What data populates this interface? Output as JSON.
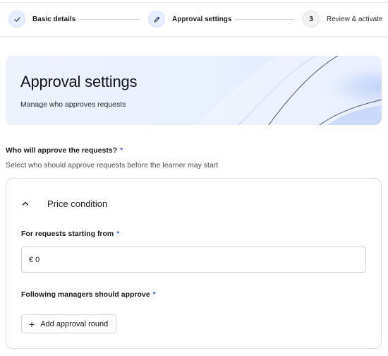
{
  "stepper": {
    "steps": [
      {
        "number": "",
        "label": "Basic details",
        "icon": "check-icon",
        "state": "completed"
      },
      {
        "number": "",
        "label": "Approval settings",
        "icon": "pencil-icon",
        "state": "current"
      },
      {
        "number": "3",
        "label": "Review & activate",
        "icon": "",
        "state": "upcoming"
      }
    ]
  },
  "hero": {
    "title": "Approval settings",
    "subtitle": "Manage who approves requests"
  },
  "approvers": {
    "question": "Who will approve the requests?",
    "required_marker": "*",
    "help_text": "Select who should approve requests before the learner may start"
  },
  "price_condition": {
    "title": "Price condition",
    "expanded": true,
    "start_label": "For requests starting from",
    "start_value": "€ 0",
    "managers_label": "Following managers should approve",
    "add_round_label": "Add approval round"
  },
  "colors": {
    "accent": "#3d63e0",
    "hero_bg": "#edf2fd",
    "border": "#dedee3"
  }
}
